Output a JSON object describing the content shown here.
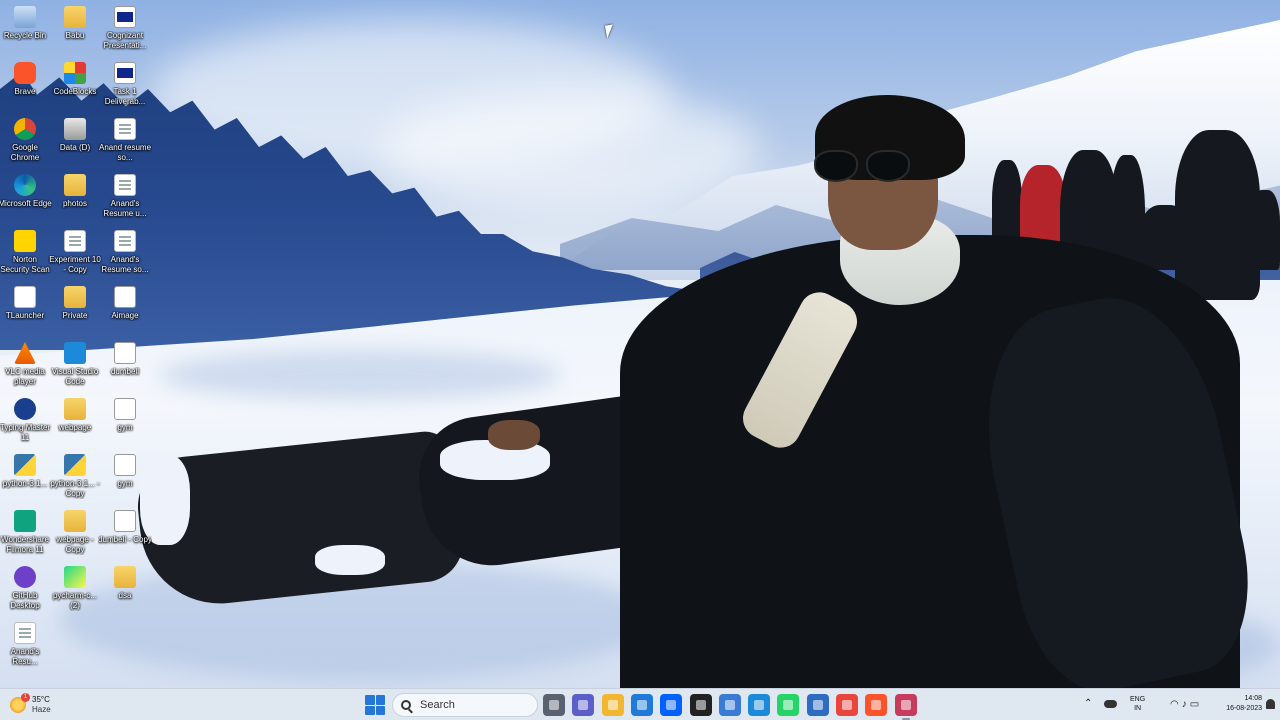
{
  "desktop": {
    "icons": [
      {
        "label": "Recycle Bin",
        "icon": "recycle-bin-icon"
      },
      {
        "label": "Babu",
        "icon": "folder-icon"
      },
      {
        "label": "Cognizant Presentati...",
        "icon": "presentation-file-icon"
      },
      {
        "label": "Brave",
        "icon": "brave-browser-icon"
      },
      {
        "label": "CodeBlocks",
        "icon": "codeblocks-icon"
      },
      {
        "label": "Task 1 Deliverab...",
        "icon": "presentation-file-icon"
      },
      {
        "label": "Google Chrome",
        "icon": "chrome-icon"
      },
      {
        "label": "Data (D)",
        "icon": "drive-icon"
      },
      {
        "label": "Anand resume so...",
        "icon": "document-icon"
      },
      {
        "label": "Microsoft Edge",
        "icon": "edge-icon"
      },
      {
        "label": "photos",
        "icon": "folder-icon"
      },
      {
        "label": "Anand's Resume u...",
        "icon": "document-icon"
      },
      {
        "label": "Norton Security Scan",
        "icon": "norton-icon"
      },
      {
        "label": "Experiment 10 - Copy",
        "icon": "document-icon"
      },
      {
        "label": "Anand's Resume so...",
        "icon": "document-icon"
      },
      {
        "label": "TLauncher",
        "icon": "file-icon"
      },
      {
        "label": "Private",
        "icon": "folder-icon"
      },
      {
        "label": "Aimage",
        "icon": "image-icon"
      },
      {
        "label": "VLC media player",
        "icon": "vlc-icon"
      },
      {
        "label": "Visual Studio Code",
        "icon": "vscode-icon"
      },
      {
        "label": "dumbell",
        "icon": "image-icon"
      },
      {
        "label": "Typing Master 11",
        "icon": "typing-master-icon"
      },
      {
        "label": "webpage",
        "icon": "folder-icon"
      },
      {
        "label": "gym",
        "icon": "image-icon"
      },
      {
        "label": "python-3.1...",
        "icon": "python-installer-icon"
      },
      {
        "label": "python-3.1... - Copy",
        "icon": "python-installer-icon"
      },
      {
        "label": "gym",
        "icon": "image-icon"
      },
      {
        "label": "Wondershare Filmora 11",
        "icon": "filmora-icon"
      },
      {
        "label": "webpage - Copy",
        "icon": "folder-icon"
      },
      {
        "label": "dumbell - Copy",
        "icon": "image-icon"
      },
      {
        "label": "GitHub Desktop",
        "icon": "github-desktop-icon"
      },
      {
        "label": "pycharm-c... (2)",
        "icon": "pycharm-icon"
      },
      {
        "label": "dsa",
        "icon": "folder-icon"
      },
      {
        "label": "Anand's Resu...",
        "icon": "document-icon"
      }
    ]
  },
  "taskbar": {
    "weather": {
      "temperature": "35°C",
      "condition": "Haze",
      "badge": "1"
    },
    "search_placeholder": "Search",
    "apps": [
      {
        "name": "task-view",
        "icon": "task-view-icon",
        "color": "#5a6270"
      },
      {
        "name": "teams-chat",
        "icon": "teams-chat-icon",
        "color": "#5b5fc7"
      },
      {
        "name": "file-explorer",
        "icon": "file-explorer-icon",
        "color": "#f2b630"
      },
      {
        "name": "edge-shortcut",
        "icon": "browser-icon",
        "color": "#1f7ad8"
      },
      {
        "name": "dropbox",
        "icon": "dropbox-icon",
        "color": "#0061fe"
      },
      {
        "name": "notion",
        "icon": "notion-icon",
        "color": "#222222"
      },
      {
        "name": "microsoft-store",
        "icon": "store-icon",
        "color": "#3a7bd5"
      },
      {
        "name": "vs-code",
        "icon": "vscode-icon",
        "color": "#1c8ad8"
      },
      {
        "name": "whatsapp",
        "icon": "whatsapp-icon",
        "color": "#25d366"
      },
      {
        "name": "codeblocks-app",
        "icon": "codeblocks-icon",
        "color": "#2d6cc0"
      },
      {
        "name": "chrome",
        "icon": "chrome-icon",
        "color": "#e8453c"
      },
      {
        "name": "brave",
        "icon": "brave-browser-icon",
        "color": "#fb542b"
      },
      {
        "name": "snipping-tool",
        "icon": "snipping-tool-icon",
        "color": "#c73b5d"
      }
    ],
    "tray": {
      "language_line1": "ENG",
      "language_line2": "IN",
      "time": "14:08",
      "date": "16-08-2023"
    }
  },
  "colors": {
    "taskbar_bg": "#dfe7f1",
    "start_blue": "#2477d8",
    "desktop_label": "#ffffff"
  }
}
